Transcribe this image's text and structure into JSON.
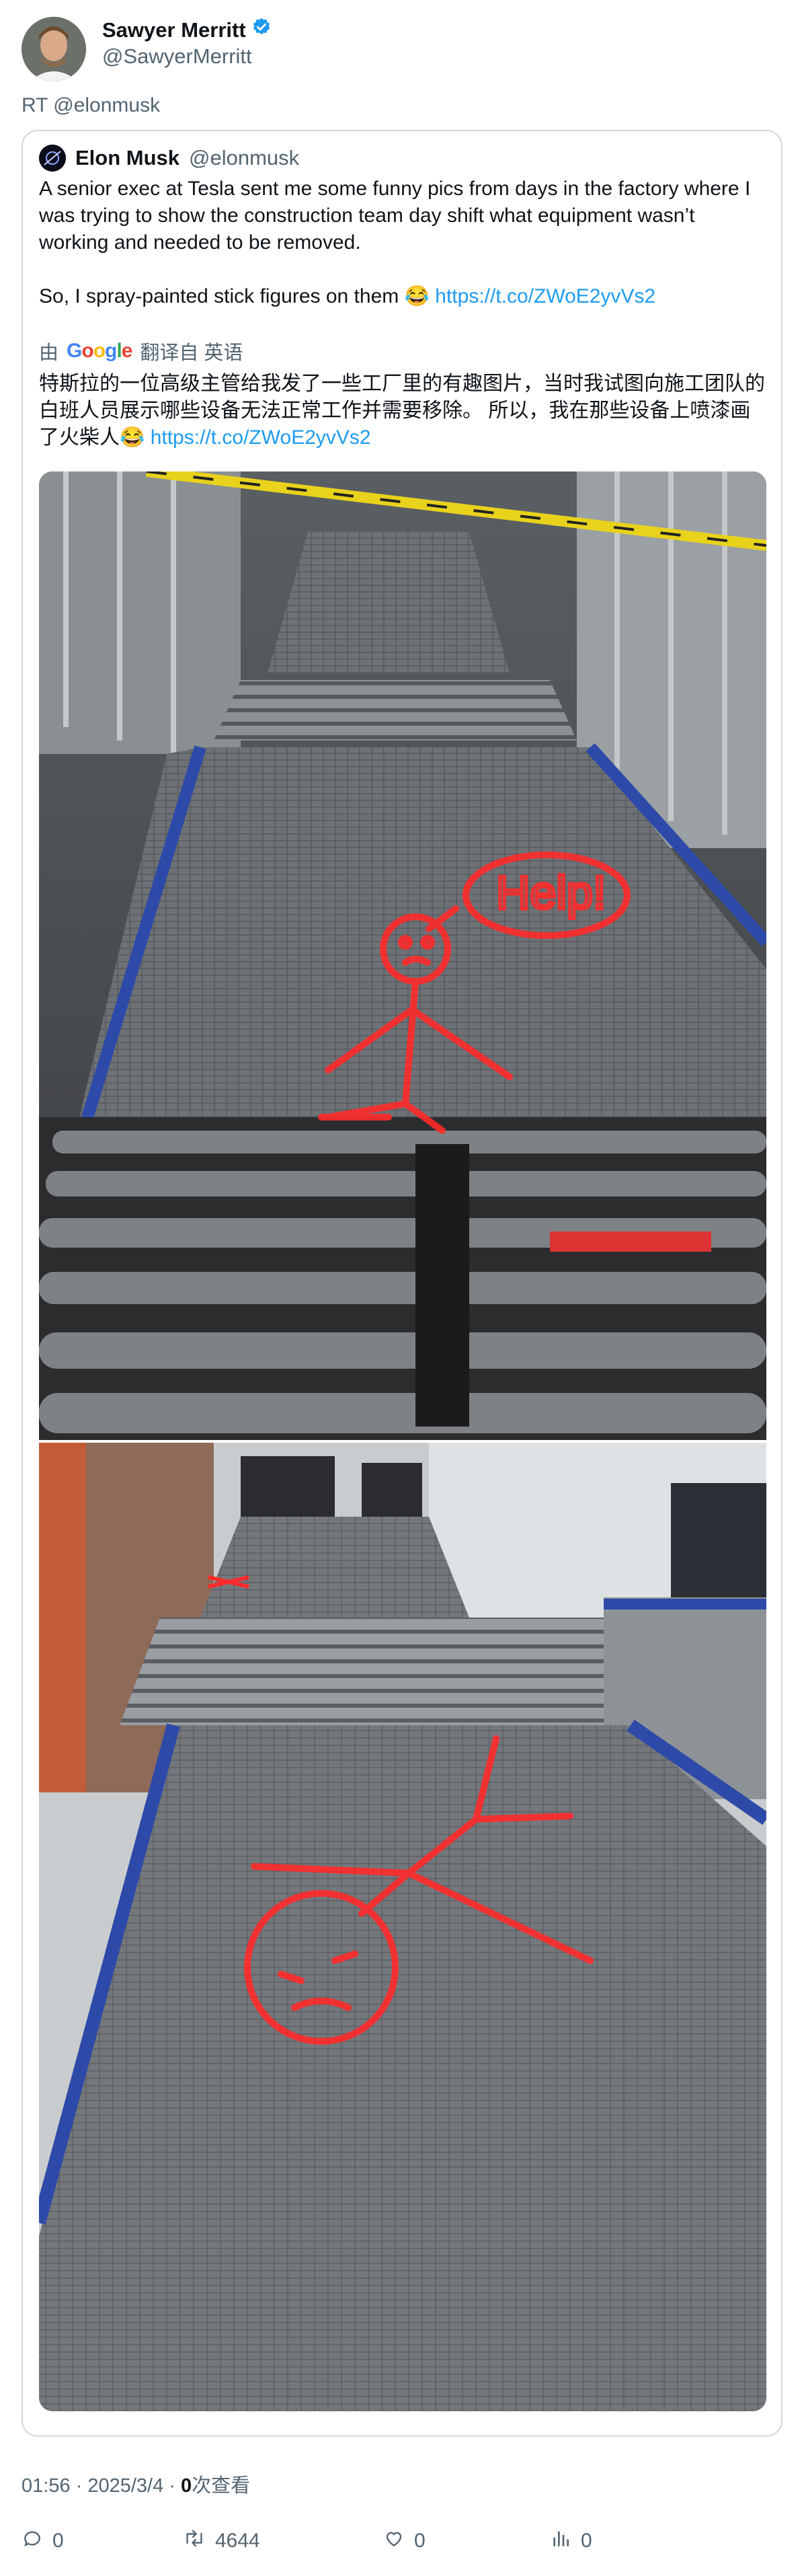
{
  "author": {
    "name": "Sawyer Merritt",
    "handle": "@SawyerMerritt",
    "verified": true
  },
  "retweet_label": "RT @elonmusk",
  "quoted": {
    "name": "Elon Musk",
    "handle": "@elonmusk",
    "text": "A senior exec at Tesla sent me some funny pics from days in the factory where I was trying to show the construction team day shift what equipment wasn’t working and needed to be removed.\n\nSo, I spray-painted stick figures on them 😂 ",
    "link": "https://t.co/ZWoE2yvVs2",
    "translation": {
      "prefix": "由",
      "provider": "Google",
      "suffix": "翻译自 英语",
      "text": "特斯拉的一位高级主管给我发了一些工厂里的有趣图片，当时我试图向施工团队的白班人员展示哪些设备无法正常工作并需要移除。 所以，我在那些设备上喷漆画了火柴人😂 ",
      "link": "https://t.co/ZWoE2yvVs2"
    },
    "images": [
      {
        "icon": "conveyor-photo-help-figure"
      },
      {
        "icon": "conveyor-photo-upside-down-figure"
      }
    ]
  },
  "meta": {
    "time": "01:56 · 2025/3/4 · ",
    "views_count": "0",
    "views_label": "次查看"
  },
  "actions": {
    "replies": "0",
    "retweets": "4644",
    "likes": "0",
    "views": "0"
  },
  "colors": {
    "link": "#1d9bf0",
    "secondary_text": "#536471",
    "verified": "#1d9bf0",
    "spray_paint": "#ff2a2a"
  }
}
